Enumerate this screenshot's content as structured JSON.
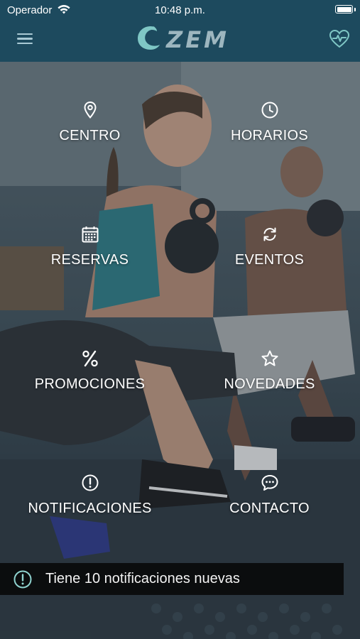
{
  "status_bar": {
    "carrier": "Operador",
    "time": "10:48 p.m."
  },
  "header": {
    "brand": "ZEM",
    "menu_icon": "hamburger-icon",
    "right_icon": "heart-pulse-icon"
  },
  "menu": {
    "items": [
      {
        "label": "CENTRO",
        "icon": "location-pin-icon"
      },
      {
        "label": "HORARIOS",
        "icon": "clock-icon"
      },
      {
        "label": "RESERVAS",
        "icon": "calendar-icon"
      },
      {
        "label": "EVENTOS",
        "icon": "refresh-icon"
      },
      {
        "label": "PROMOCIONES",
        "icon": "percent-icon"
      },
      {
        "label": "NOVEDADES",
        "icon": "star-icon"
      },
      {
        "label": "NOTIFICACIONES",
        "icon": "alert-circle-icon"
      },
      {
        "label": "CONTACTO",
        "icon": "chat-bubble-icon"
      }
    ]
  },
  "notification": {
    "text": "Tiene 10 notificaciones nuevas",
    "icon": "alert-circle-icon"
  },
  "colors": {
    "header_bg": "#1d4a5e",
    "accent": "#7fc7c5",
    "notification_bg": "#0b0d0e"
  }
}
